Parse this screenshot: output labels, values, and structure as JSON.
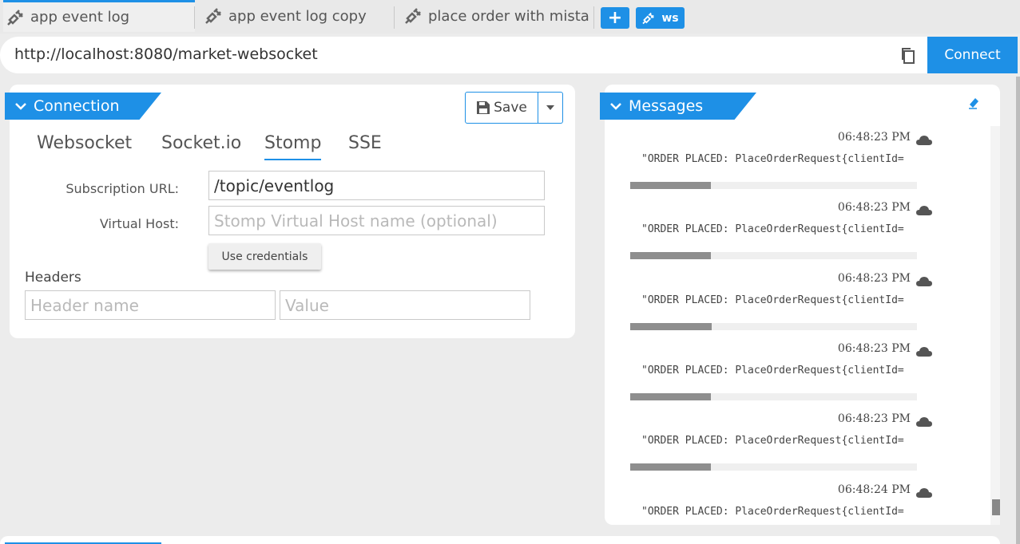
{
  "tabs": [
    {
      "label": "app event log",
      "active": true
    },
    {
      "label": "app event log copy",
      "active": false
    },
    {
      "label": "place order with mista...",
      "active": false
    }
  ],
  "tabbar": {
    "add_label": "+",
    "ws_label": "ws"
  },
  "url": {
    "value": "http://localhost:8080/market-websocket",
    "connect_label": "Connect"
  },
  "connection": {
    "title": "Connection",
    "save_label": "Save",
    "protocol_tabs": [
      "Websocket",
      "Socket.io",
      "Stomp",
      "SSE"
    ],
    "active_protocol": "Stomp",
    "subscription_url_label": "Subscription URL:",
    "subscription_url_value": "/topic/eventlog",
    "virtual_host_label": "Virtual Host:",
    "virtual_host_placeholder": "Stomp Virtual Host name (optional)",
    "use_credentials_label": "Use credentials",
    "headers_label": "Headers",
    "header_name_placeholder": "Header name",
    "header_value_placeholder": "Value"
  },
  "messages": {
    "title": "Messages",
    "items": [
      {
        "time": "06:48:23  PM",
        "text": "\"ORDER PLACED: PlaceOrderRequest{clientId=",
        "progress": 0.28
      },
      {
        "time": "06:48:23  PM",
        "text": "\"ORDER PLACED: PlaceOrderRequest{clientId=",
        "progress": 0.28
      },
      {
        "time": "06:48:23  PM",
        "text": "\"ORDER PLACED: PlaceOrderRequest{clientId=",
        "progress": 0.285
      },
      {
        "time": "06:48:23  PM",
        "text": "\"ORDER PLACED: PlaceOrderRequest{clientId=",
        "progress": 0.28
      },
      {
        "time": "06:48:23  PM",
        "text": "\"ORDER PLACED: PlaceOrderRequest{clientId=",
        "progress": 0.28
      },
      {
        "time": "06:48:24  PM",
        "text": "\"ORDER PLACED: PlaceOrderRequest{clientId=",
        "progress": null
      }
    ]
  },
  "colors": {
    "accent": "#1e90e6"
  }
}
